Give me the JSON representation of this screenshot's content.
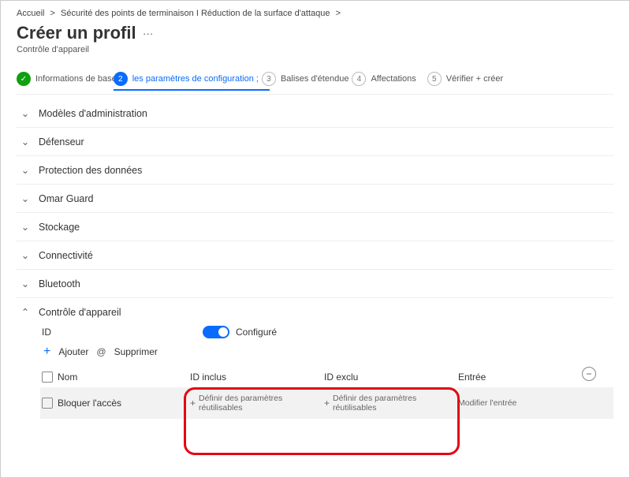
{
  "breadcrumb": {
    "home": "Accueil",
    "sep": "&gt;",
    "path": "Sécurité des points de terminaison I Réduction de la surface d'attaque",
    "tail": ">"
  },
  "title": "Créer un profil",
  "title_actions": "…",
  "subtitle": "Contrôle d'appareil",
  "steps": {
    "s1": {
      "label": "Informations de base",
      "icon": "✓"
    },
    "s2": {
      "num": "2",
      "label": "les paramètres de configuration ;"
    },
    "s3": {
      "num": "3",
      "label": "Balises d'étendue"
    },
    "s4": {
      "num": "4",
      "label": "Affectations"
    },
    "s5": {
      "num": "5",
      "label": "Vérifier + créer"
    }
  },
  "accordion": {
    "items": [
      {
        "label": "Modèles d'administration",
        "open": false
      },
      {
        "label": "Défenseur",
        "open": false
      },
      {
        "label": "Protection des données",
        "open": false
      },
      {
        "label": "Omar Guard",
        "open": false
      },
      {
        "label": "Stockage",
        "open": false
      },
      {
        "label": "Connectivité",
        "open": false
      },
      {
        "label": "Bluetooth",
        "open": false
      },
      {
        "label": "Contrôle d'appareil",
        "open": true
      }
    ]
  },
  "device_control": {
    "id_label": "ID",
    "configured": "Configuré",
    "add": "Ajouter",
    "at": "@",
    "remove": "Supprimer",
    "columns": {
      "name": "Nom",
      "inc": "ID inclus",
      "exc": "ID exclu",
      "entry": "Entrée"
    },
    "row": {
      "name": "Bloquer l'accès",
      "inc_link": "Définir des paramètres réutilisables",
      "exc_link": "Définir des paramètres réutilisables",
      "entry_link": "Modifier l'entrée"
    },
    "plus": "+",
    "minus": "−"
  }
}
